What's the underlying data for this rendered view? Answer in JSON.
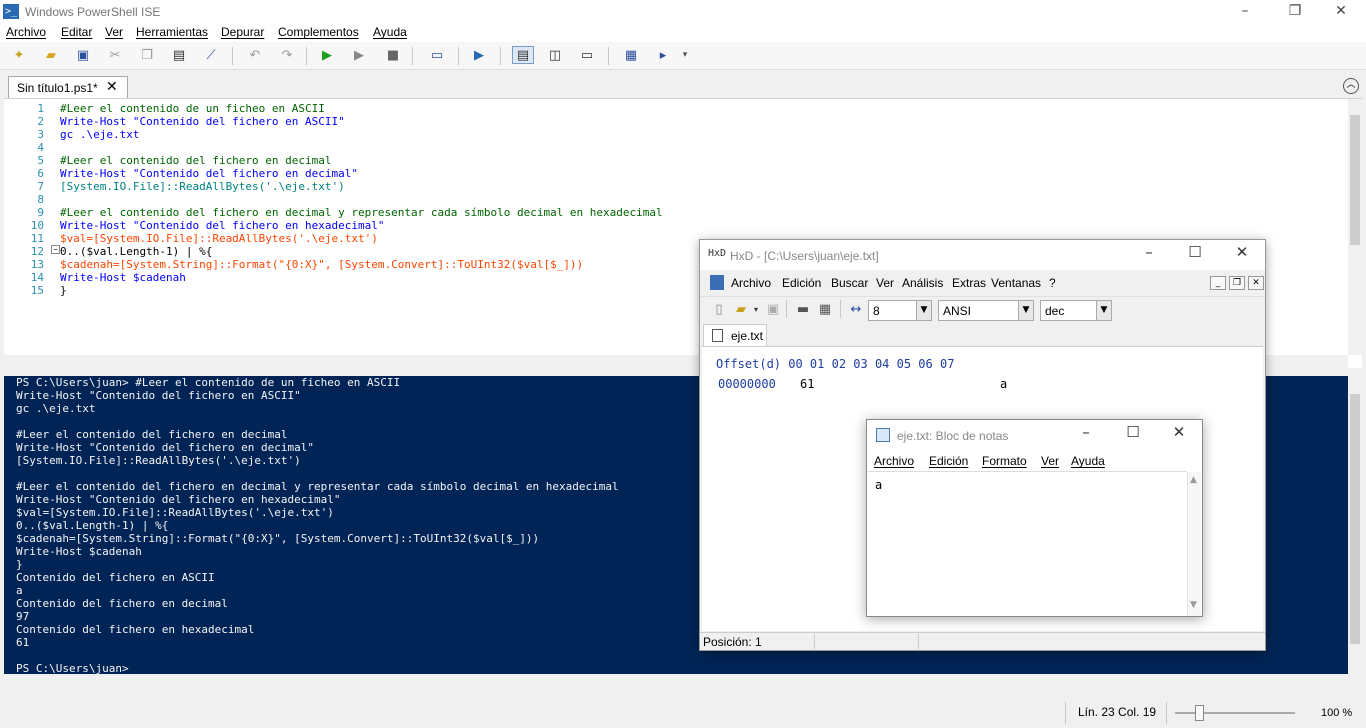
{
  "app": {
    "title": "Windows PowerShell ISE"
  },
  "menu": [
    "Archivo",
    "Editar",
    "Ver",
    "Herramientas",
    "Depurar",
    "Complementos",
    "Ayuda"
  ],
  "tabs": [
    {
      "label": "Sin título1.ps1*"
    }
  ],
  "editor": {
    "line_numbers": [
      "1",
      "2",
      "3",
      "4",
      "5",
      "6",
      "7",
      "8",
      "9",
      "10",
      "11",
      "12",
      "13",
      "14",
      "15"
    ],
    "lines": [
      "#Leer el contenido de un ficheo en ASCII",
      "Write-Host \"Contenido del fichero en ASCII\"",
      "gc .\\eje.txt",
      "",
      "#Leer el contenido del fichero en decimal",
      "Write-Host \"Contenido del fichero en decimal\"",
      "[System.IO.File]::ReadAllBytes('.\\eje.txt')",
      "",
      "#Leer el contenido del fichero en decimal y representar cada símbolo decimal en hexadecimal",
      "Write-Host \"Contenido del fichero en hexadecimal\"",
      "$val=[System.IO.File]::ReadAllBytes('.\\eje.txt')",
      "0..($val.Length-1) | %{",
      "$cadenah=[System.String]::Format(\"{0:X}\", [System.Convert]::ToUInt32($val[$_]))",
      "Write-Host $cadenah",
      "}"
    ]
  },
  "console": {
    "lines": [
      "PS C:\\Users\\juan> #Leer el contenido de un ficheo en ASCII",
      "Write-Host \"Contenido del fichero en ASCII\"",
      "gc .\\eje.txt",
      "",
      "#Leer el contenido del fichero en decimal",
      "Write-Host \"Contenido del fichero en decimal\"",
      "[System.IO.File]::ReadAllBytes('.\\eje.txt')",
      "",
      "#Leer el contenido del fichero en decimal y representar cada símbolo decimal en hexadecimal",
      "Write-Host \"Contenido del fichero en hexadecimal\"",
      "$val=[System.IO.File]::ReadAllBytes('.\\eje.txt')",
      "0..($val.Length-1) | %{",
      "$cadenah=[System.String]::Format(\"{0:X}\", [System.Convert]::ToUInt32($val[$_]))",
      "Write-Host $cadenah",
      "}",
      "Contenido del fichero en ASCII",
      "a",
      "Contenido del fichero en decimal",
      "97",
      "Contenido del fichero en hexadecimal",
      "61",
      "",
      "PS C:\\Users\\juan>"
    ]
  },
  "status": {
    "position": "Lín. 23  Col. 19",
    "zoom": "100 %",
    "zoom_level": 0.2
  },
  "hxd": {
    "title": "HxD - [C:\\Users\\juan\\eje.txt]",
    "menu": [
      "Archivo",
      "Edición",
      "Buscar",
      "Ver",
      "Análisis",
      "Extras",
      "Ventanas",
      "?"
    ],
    "bytes_per_row": "8",
    "charset": "ANSI",
    "offset_base": "dec",
    "tab": "eje.txt",
    "header": "Offset(d) 00 01 02 03 04 05 06 07",
    "offset": "00000000",
    "byte0": "61",
    "ascii": "a",
    "status": "Posición: 1"
  },
  "notepad": {
    "title": "eje.txt: Bloc de notas",
    "menu": [
      "Archivo",
      "Edición",
      "Formato",
      "Ver",
      "Ayuda"
    ],
    "content": "a"
  }
}
